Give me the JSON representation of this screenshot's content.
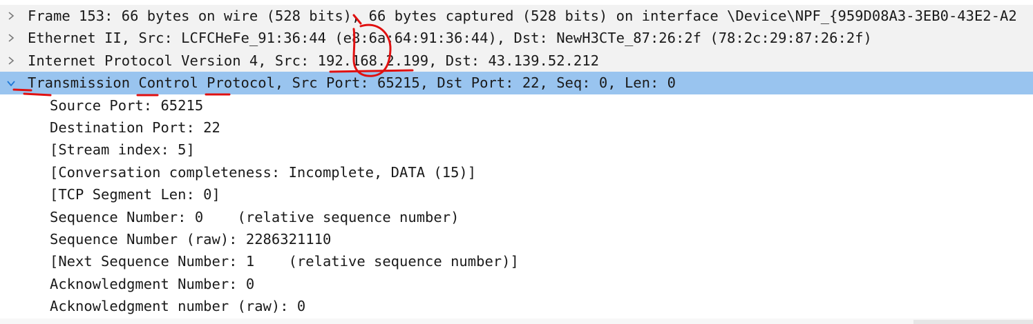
{
  "packet_tree": {
    "items": [
      {
        "text": "Frame 153: 66 bytes on wire (528 bits), 66 bytes captured (528 bits) on interface \\Device\\NPF_{959D08A3-3EB0-43E2-A2"
      },
      {
        "text": "Ethernet II, Src: LCFCHeFe_91:36:44 (e8:6a:64:91:36:44), Dst: NewH3CTe_87:26:2f (78:2c:29:87:26:2f)"
      },
      {
        "text": "Internet Protocol Version 4, Src: 192.168.2.199, Dst: 43.139.52.212"
      },
      {
        "text": "Transmission Control Protocol, Src Port: 65215, Dst Port: 22, Seq: 0, Len: 0"
      }
    ],
    "tcp_fields": [
      "Source Port: 65215",
      "Destination Port: 22",
      "[Stream index: 5]",
      "[Conversation completeness: Incomplete, DATA (15)]",
      "[TCP Segment Len: 0]",
      "Sequence Number: 0    (relative sequence number)",
      "Sequence Number (raw): 2286321110",
      "[Next Sequence Number: 1    (relative sequence number)]",
      "Acknowledgment Number: 0",
      "Acknowledgment number (raw): 0"
    ]
  },
  "colors": {
    "selected_row": "#99c4ef",
    "collapsed_row": "#f2f2f2",
    "annotation": "#e01010",
    "expanded_arrow": "#1e78d6",
    "collapsed_arrow": "#7a7a7a"
  },
  "icons": {
    "collapsed": "chevron-right-icon",
    "expanded": "chevron-down-icon"
  }
}
